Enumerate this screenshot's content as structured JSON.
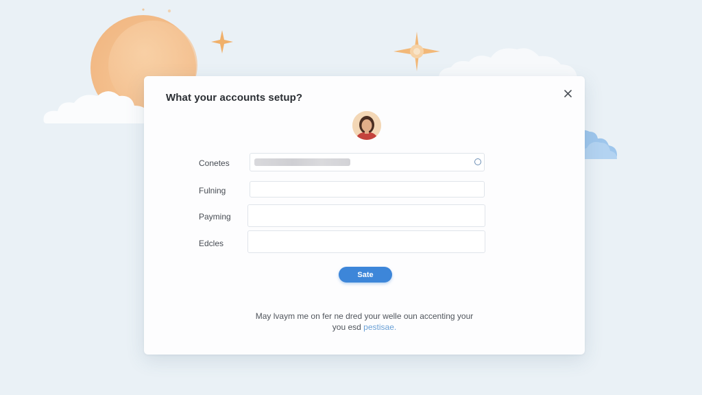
{
  "dialog": {
    "title": "What your accounts setup?",
    "close_icon": "close-icon",
    "avatar": "user-avatar",
    "fields": [
      {
        "label": "Conetes",
        "value": "",
        "redacted": true
      },
      {
        "label": "Fulning",
        "value": ""
      },
      {
        "label": "Payming",
        "value": ""
      },
      {
        "label": "Edcles",
        "value": ""
      }
    ],
    "save_label": "Sate",
    "footer_text": "May lvaym me on fer ne dred your welle oun accenting your",
    "footer_text_2": "you esd",
    "footer_link": "pestisae."
  },
  "colors": {
    "background": "#eaf1f6",
    "accent": "#3d86d9",
    "sun": "#f3bd8a",
    "sparkle": "#f0b06a",
    "cloud_blue": "#9ec6ec"
  }
}
